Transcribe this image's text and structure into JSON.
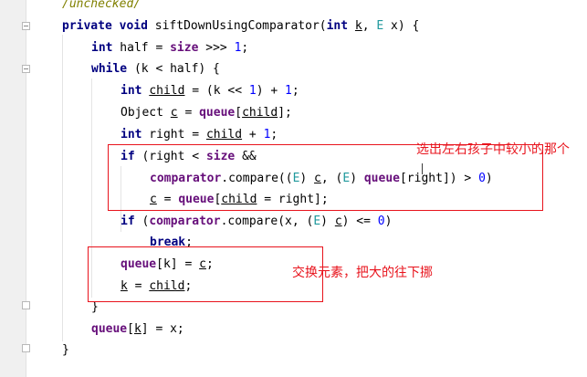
{
  "editor": {
    "comment": "/unchecked/",
    "lines": {
      "sig": {
        "kw1": "private",
        "kw2": "void",
        "name": " siftDownUsingComparator(",
        "kw3": "int",
        "sp": " ",
        "k": "k",
        "comma": ", ",
        "E": "E",
        "rest": " x) {"
      },
      "half": {
        "kw": "int",
        "a": " half = ",
        "fld": "size",
        "b": " >>> ",
        "num": "1",
        "c": ";"
      },
      "while": {
        "kw": "while",
        "rest": " (k < half) {"
      },
      "child": {
        "kw": "int",
        "sp": " ",
        "var": "child",
        "a": " = (k << ",
        "n1": "1",
        "b": ") + ",
        "n2": "1",
        "c": ";"
      },
      "obj": {
        "a": "Object ",
        "var": "c",
        "b": " = ",
        "fld": "queue",
        "c": "[",
        "var2": "child",
        "d": "];"
      },
      "right": {
        "kw": "int",
        "a": " right = ",
        "var": "child",
        "b": " + ",
        "num": "1",
        "c": ";"
      },
      "if1": {
        "kw": "if",
        "a": " (right < ",
        "fld": "size",
        "b": " &&"
      },
      "cmp1": {
        "fld": "comparator",
        "a": ".compare((",
        "E1": "E",
        "b": ") ",
        "v1": "c",
        "c": ", (",
        "E2": "E",
        "d": ") ",
        "fld2": "queue",
        "e": "[right]) > ",
        "num": "0",
        "f": ")"
      },
      "assign": {
        "var": "c",
        "a": " = ",
        "fld": "queue",
        "b": "[",
        "var2": "child",
        "c": " = right];"
      },
      "if2": {
        "kw": "if",
        "a": " (",
        "fld": "comparator",
        "b": ".compare(x, (",
        "E": "E",
        "c": ") ",
        "var": "c",
        "d": ") <= ",
        "num": "0",
        "e": ")"
      },
      "brk": {
        "kw": "break",
        "a": ";"
      },
      "qk": {
        "fld": "queue",
        "a": "[k] = ",
        "var": "c",
        "b": ";"
      },
      "kc": {
        "var": "k",
        "a": " = ",
        "var2": "child",
        "b": ";"
      },
      "close1": "}",
      "qx": {
        "fld": "queue",
        "a": "[",
        "var": "k",
        "b": "] = x;"
      },
      "close2": "}"
    }
  },
  "annotations": {
    "note1": "选出左右孩子中较小的那个",
    "note2": "交换元素，把大的往下挪"
  }
}
